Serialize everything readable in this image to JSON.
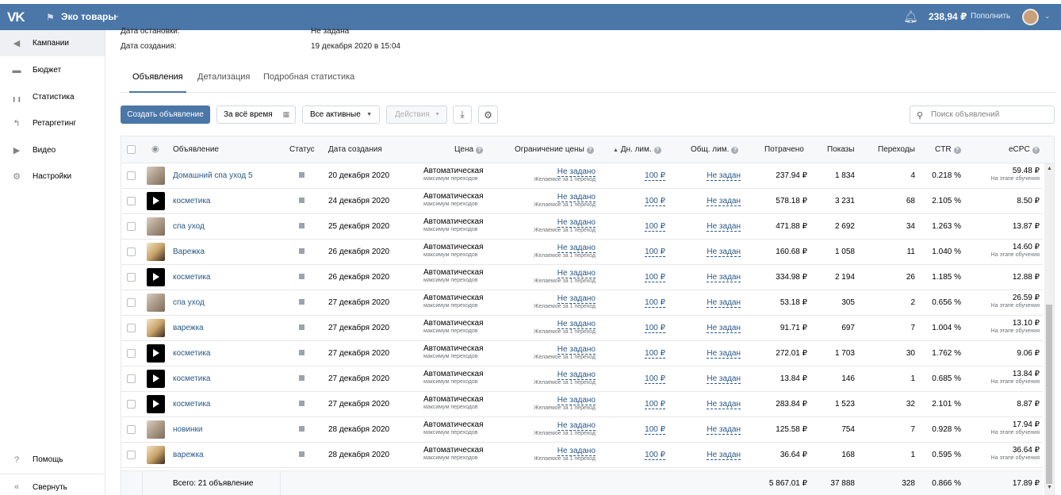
{
  "topbar": {
    "logo": "VK",
    "account_name": "Эко товары",
    "balance": "238,94 ₽",
    "topup_label": "Пополнить"
  },
  "sidebar": {
    "items": [
      {
        "label": "Кампании",
        "icon": "megaphone-icon"
      },
      {
        "label": "Бюджет",
        "icon": "wallet-icon"
      },
      {
        "label": "Статистика",
        "icon": "stats-icon"
      },
      {
        "label": "Ретаргетинг",
        "icon": "retarget-icon"
      },
      {
        "label": "Видео",
        "icon": "video-icon"
      },
      {
        "label": "Настройки",
        "icon": "gear-icon"
      }
    ],
    "help": "Помощь",
    "collapse": "Свернуть"
  },
  "info": {
    "stop_label": "Дата остановки:",
    "stop_value": "Не задана",
    "created_label": "Дата создания:",
    "created_value": "19 декабря 2020 в 15:04"
  },
  "tabs": [
    "Объявления",
    "Детализация",
    "Подробная статистика"
  ],
  "toolbar": {
    "create": "Создать объявление",
    "period": "За всё время",
    "filter": "Все активные",
    "actions": "Действия",
    "search_placeholder": "Поиск объявлений"
  },
  "table": {
    "headers": {
      "ad": "Объявление",
      "status": "Статус",
      "created": "Дата создания",
      "price": "Цена",
      "price_limit": "Ограничение цены",
      "daily_limit": "Дн. лим.",
      "total_limit": "Общ. лим.",
      "spent": "Потрачено",
      "impressions": "Показы",
      "clicks": "Переходы",
      "ctr": "CTR",
      "ecpc": "eCPC"
    },
    "price_main": "Автоматическая",
    "price_sub": "максимум переходов",
    "limit_main": "Не задано",
    "limit_sub": "Желаемое за 1 переход",
    "daily": "100 ₽",
    "total": "Не задан",
    "learning": "На этапе обучения",
    "rows": [
      {
        "thumb": "photo",
        "name": "Домашний спа уход 5",
        "date": "20 декабря 2020",
        "spent": "237.94 ₽",
        "shows": "1 834",
        "clicks": "4",
        "ctr": "0.218 %",
        "ecpc": "59.48 ₽",
        "learning": true
      },
      {
        "thumb": "black",
        "name": "косметика",
        "date": "24 декабря 2020",
        "spent": "578.18 ₽",
        "shows": "3 231",
        "clicks": "68",
        "ctr": "2.105 %",
        "ecpc": "8.50 ₽",
        "learning": false
      },
      {
        "thumb": "photo",
        "name": "спа уход",
        "date": "25 декабря 2020",
        "spent": "471.88 ₽",
        "shows": "2 692",
        "clicks": "34",
        "ctr": "1.263 %",
        "ecpc": "13.87 ₽",
        "learning": false
      },
      {
        "thumb": "mitt",
        "name": "Варежка",
        "date": "26 декабря 2020",
        "spent": "160.68 ₽",
        "shows": "1 058",
        "clicks": "11",
        "ctr": "1.040 %",
        "ecpc": "14.60 ₽",
        "learning": true
      },
      {
        "thumb": "black",
        "name": "косметика",
        "date": "26 декабря 2020",
        "spent": "334.98 ₽",
        "shows": "2 194",
        "clicks": "26",
        "ctr": "1.185 %",
        "ecpc": "12.88 ₽",
        "learning": false
      },
      {
        "thumb": "photo",
        "name": "спа уход",
        "date": "27 декабря 2020",
        "spent": "53.18 ₽",
        "shows": "305",
        "clicks": "2",
        "ctr": "0.656 %",
        "ecpc": "26.59 ₽",
        "learning": true
      },
      {
        "thumb": "mitt",
        "name": "варежка",
        "date": "27 декабря 2020",
        "spent": "91.71 ₽",
        "shows": "697",
        "clicks": "7",
        "ctr": "1.004 %",
        "ecpc": "13.10 ₽",
        "learning": true
      },
      {
        "thumb": "black",
        "name": "косметика",
        "date": "27 декабря 2020",
        "spent": "272.01 ₽",
        "shows": "1 703",
        "clicks": "30",
        "ctr": "1.762 %",
        "ecpc": "9.06 ₽",
        "learning": false
      },
      {
        "thumb": "black",
        "name": "косметика",
        "date": "27 декабря 2020",
        "spent": "13.84 ₽",
        "shows": "146",
        "clicks": "1",
        "ctr": "0.685 %",
        "ecpc": "13.84 ₽",
        "learning": true
      },
      {
        "thumb": "black",
        "name": "косметика",
        "date": "27 декабря 2020",
        "spent": "283.84 ₽",
        "shows": "1 523",
        "clicks": "32",
        "ctr": "2.101 %",
        "ecpc": "8.87 ₽",
        "learning": false
      },
      {
        "thumb": "photo",
        "name": "новинки",
        "date": "28 декабря 2020",
        "spent": "125.58 ₽",
        "shows": "754",
        "clicks": "7",
        "ctr": "0.928 %",
        "ecpc": "17.94 ₽",
        "learning": true
      },
      {
        "thumb": "mitt",
        "name": "варежка",
        "date": "28 декабря 2020",
        "spent": "36.64 ₽",
        "shows": "168",
        "clicks": "1",
        "ctr": "0.595 %",
        "ecpc": "36.64 ₽",
        "learning": true
      }
    ],
    "totals": {
      "label": "Всего: 21 объявление",
      "spent": "5 867.01 ₽",
      "shows": "37 888",
      "clicks": "328",
      "ctr": "0.866 %",
      "ecpc": "17.89 ₽"
    }
  }
}
